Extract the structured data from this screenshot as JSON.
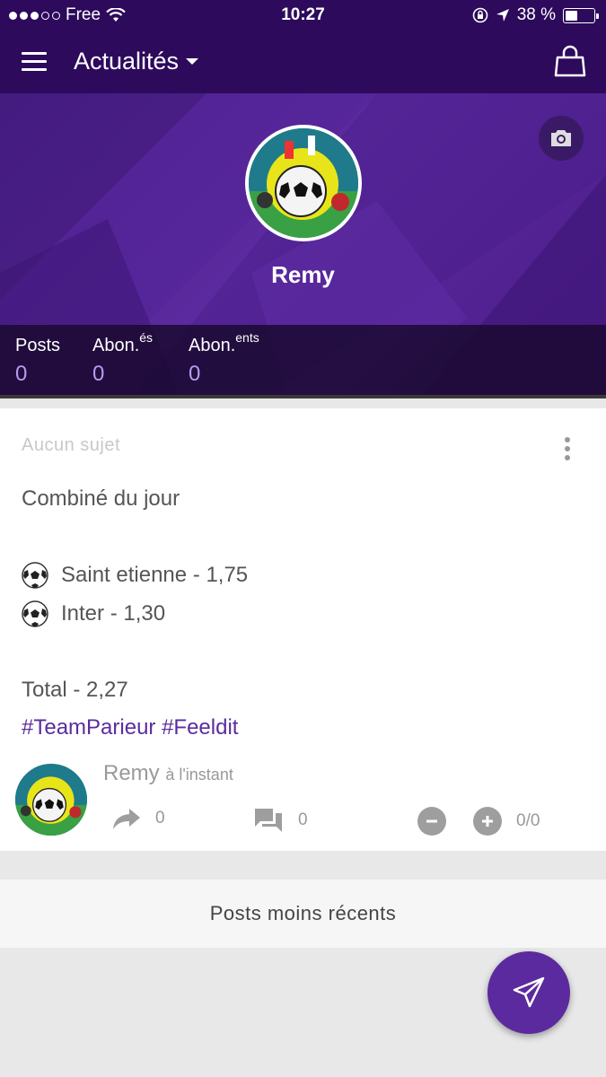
{
  "status_bar": {
    "carrier": "Free",
    "time": "10:27",
    "battery": "38 %",
    "battery_level": 0.38
  },
  "app_bar": {
    "title": "Actualités"
  },
  "profile": {
    "name": "Remy",
    "stats": [
      {
        "label": "Posts",
        "sup": "",
        "value": "0"
      },
      {
        "label": "Abon.",
        "sup": "és",
        "value": "0"
      },
      {
        "label": "Abon.",
        "sup": "ents",
        "value": "0"
      }
    ]
  },
  "post": {
    "subject": "Aucun sujet",
    "lines": {
      "title": "Combiné du jour",
      "pick1": "Saint etienne - 1,75",
      "pick2": "Inter - 1,30",
      "total": "Total - 2,27",
      "hashtags": "#TeamParieur #Feeldit"
    },
    "author": "Remy",
    "time": "à l'instant",
    "share_count": "0",
    "comment_count": "0",
    "vote_score": "0/0"
  },
  "older_posts_label": "Posts moins récents",
  "colors": {
    "primary": "#2d0a5c",
    "accent": "#5b2a9e",
    "stat_value": "#b79bf0"
  }
}
